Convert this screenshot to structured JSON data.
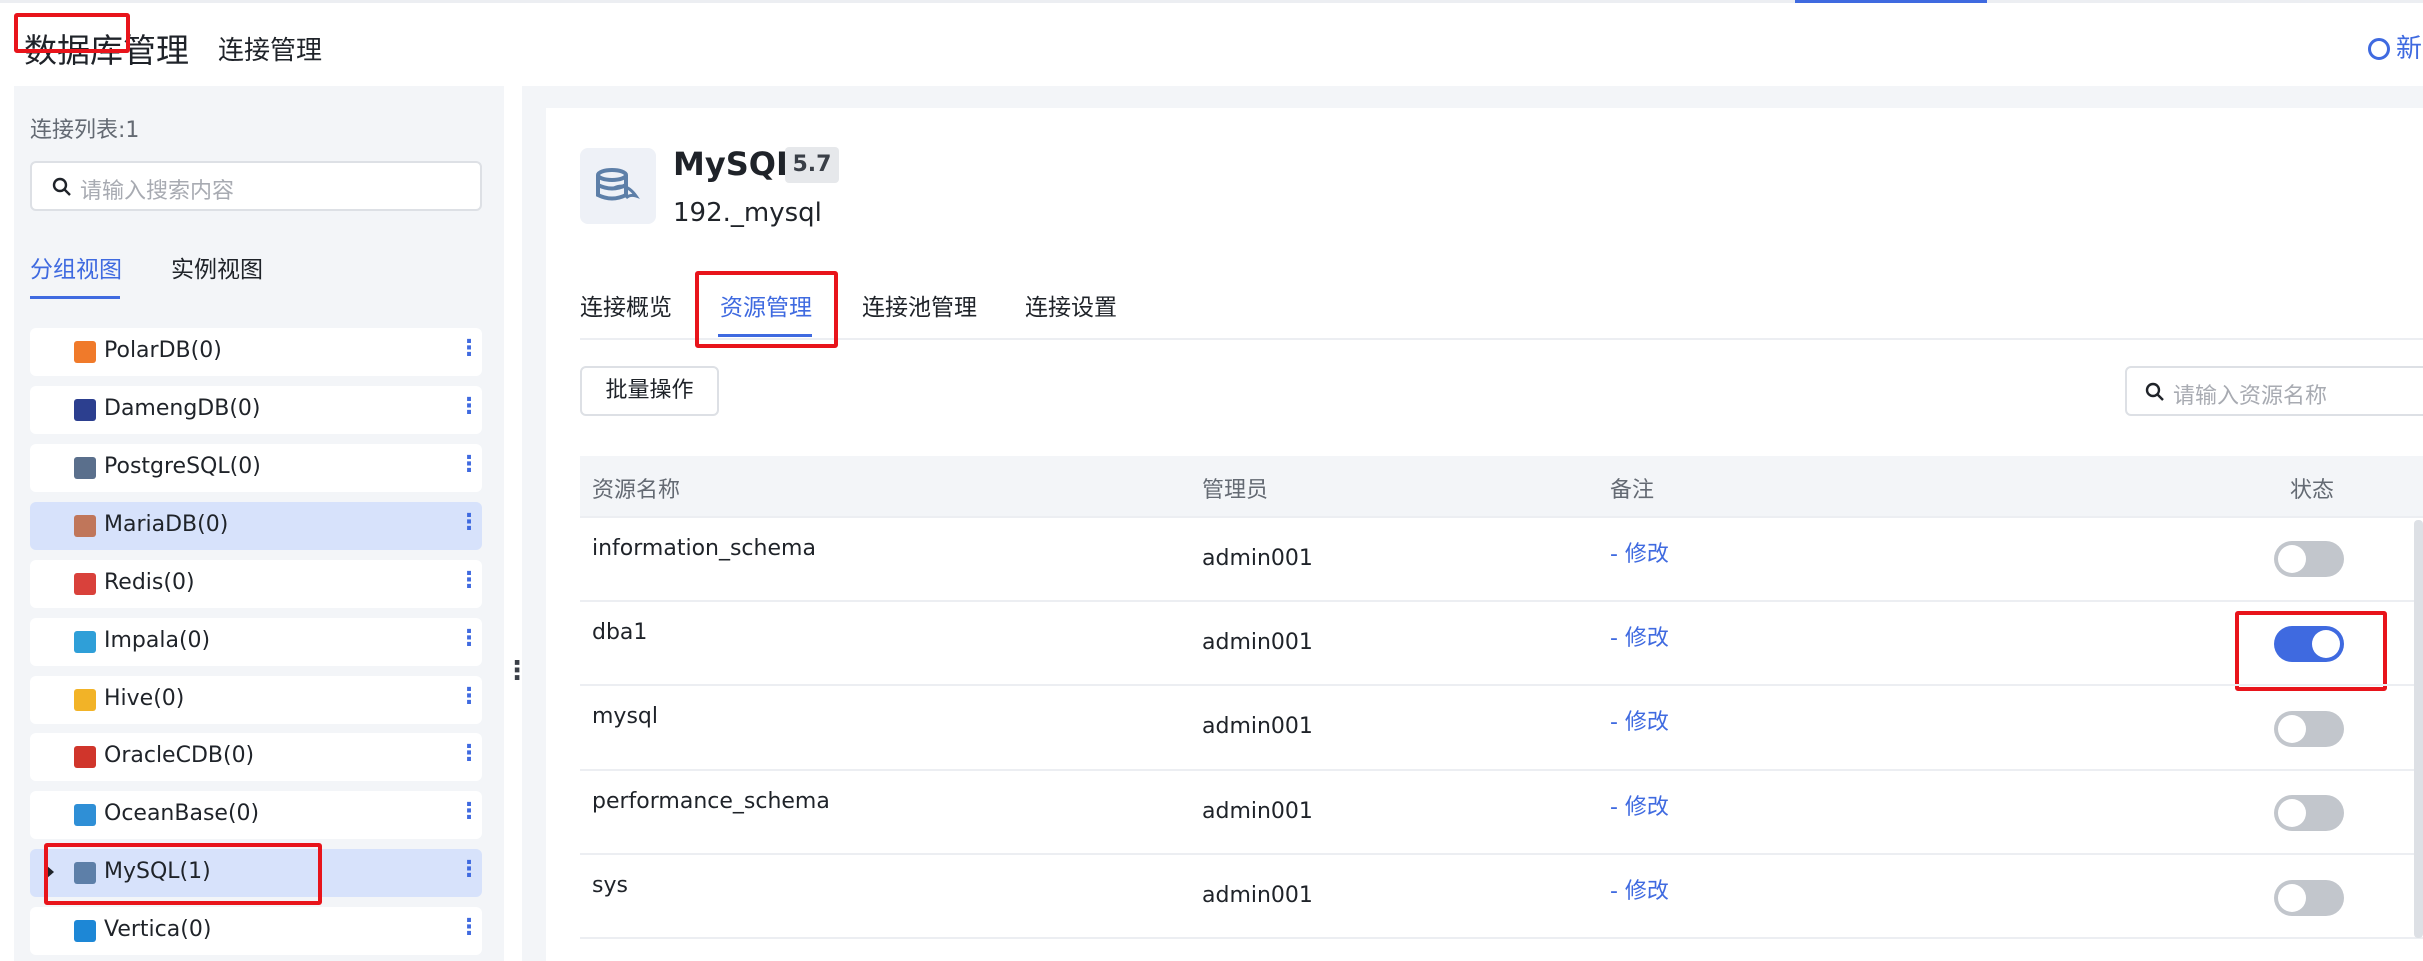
{
  "header": {
    "title": "数据库管理",
    "subtitle": "连接管理",
    "new_button": "新建"
  },
  "sidebar": {
    "conn_count": "连接列表:1",
    "search_placeholder": "请输入搜索内容",
    "tabs": [
      "分组视图",
      "实例视图"
    ],
    "items": [
      {
        "label": "PolarDB(0)",
        "icon_color": "#f07a2a"
      },
      {
        "label": "DamengDB(0)",
        "icon_color": "#2c3f8f"
      },
      {
        "label": "PostgreSQL(0)",
        "icon_color": "#5a6f8c"
      },
      {
        "label": "MariaDB(0)",
        "icon_color": "#c0765a"
      },
      {
        "label": "Redis(0)",
        "icon_color": "#d9413b"
      },
      {
        "label": "Impala(0)",
        "icon_color": "#2f9fd8"
      },
      {
        "label": "Hive(0)",
        "icon_color": "#f2b327"
      },
      {
        "label": "OracleCDB(0)",
        "icon_color": "#d0352b"
      },
      {
        "label": "OceanBase(0)",
        "icon_color": "#2f8fd6"
      },
      {
        "label": "MySQL(1)",
        "icon_color": "#5d7fa8"
      },
      {
        "label": "Vertica(0)",
        "icon_color": "#1d87d6"
      }
    ]
  },
  "detail": {
    "db_name": "MySQL",
    "version": "5.7",
    "conn_addr": "192._mysql",
    "tabs": [
      "连接概览",
      "资源管理",
      "连接池管理",
      "连接设置"
    ],
    "batch_label": "批量操作",
    "search_placeholder": "请输入资源名称",
    "table": {
      "headers": [
        "资源名称",
        "管理员",
        "备注",
        "状态"
      ],
      "rows": [
        {
          "name": "information_schema",
          "admin": "admin001",
          "note": "- 修改",
          "enabled": false
        },
        {
          "name": "dba1",
          "admin": "admin001",
          "note": "- 修改",
          "enabled": true
        },
        {
          "name": "mysql",
          "admin": "admin001",
          "note": "- 修改",
          "enabled": false
        },
        {
          "name": "performance_schema",
          "admin": "admin001",
          "note": "- 修改",
          "enabled": false
        },
        {
          "name": "sys",
          "admin": "admin001",
          "note": "- 修改",
          "enabled": false
        }
      ]
    }
  },
  "colors": {
    "accent": "#3f6ae0",
    "highlight": "#e8141b",
    "panel_bg": "#f3f5f8",
    "selected_bg": "#d7e2fb"
  }
}
